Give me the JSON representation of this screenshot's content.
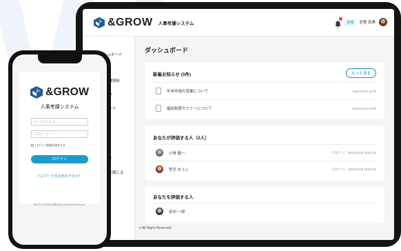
{
  "tablet": {
    "brand": "&GROW",
    "app_name": "人事考課システム",
    "role_badge": "管理",
    "user_name": "安室 奈美",
    "sidebar": [
      {
        "label": "ダッシュボード"
      },
      {
        "label": "ト"
      },
      {
        "label": "考課資料"
      },
      {
        "label": "より"
      },
      {
        "label": "ワード"
      },
      {
        "label": "ウト"
      },
      {
        "label": "ーを閉じる"
      }
    ],
    "page_title": "ダッシュボード",
    "news": {
      "title": "新着お知らせ (5件)",
      "more": "もっと見る",
      "items": [
        {
          "text": "年末年始の営業について",
          "date": "2022/11/20 11:00"
        },
        {
          "text": "福祉制度セミナーについて",
          "date": "2022/11/16 19:00"
        }
      ]
    },
    "evaluatees": {
      "title": "あなたが評価する人（2人）",
      "items": [
        {
          "name": "小林 健一",
          "login": "ログイン：2022/11/20 10:52:46"
        },
        {
          "name": "荒字 ゆうこ",
          "login": "ログイン：2022/11/19 19:54:23"
        }
      ]
    },
    "evaluators": {
      "title": "あなたを評価する人",
      "items": [
        {
          "name": "田中 一郎"
        }
      ]
    },
    "footer": "e All Righs Reserved."
  },
  "phone": {
    "brand": "&GROW",
    "system_name": "人事考課システム",
    "email_placeholder": "メールアドレス",
    "password_placeholder": "パスワード",
    "remember": "ログイン情報を保存する",
    "login_button": "ログイン",
    "forgot": "パスワードをお忘れですか？",
    "copyright": "HBODY PIONEER株式会社 All Rights Reserved."
  },
  "colors": {
    "accent": "#1a9bc9",
    "logo_dark": "#2a5a8a",
    "logo_light": "#5bb8e0"
  }
}
